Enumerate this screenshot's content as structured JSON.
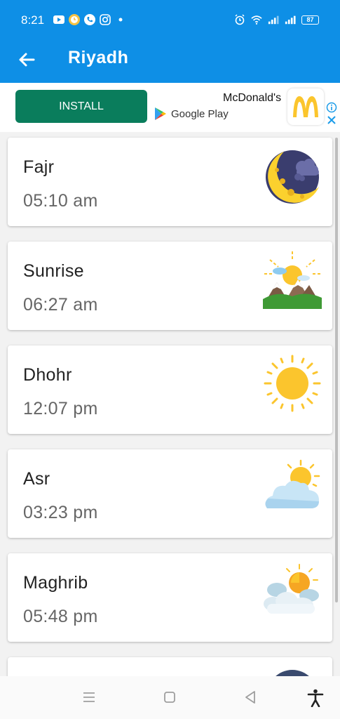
{
  "status_bar": {
    "time": "8:21",
    "battery": "87",
    "left_icons": [
      "youtube-icon",
      "clock-app-icon",
      "phone-icon",
      "instagram-icon",
      "dot-icon"
    ],
    "right_icons": [
      "alarm-icon",
      "wifi-icon",
      "signal-icon",
      "signal-icon",
      "battery-icon"
    ]
  },
  "app_bar": {
    "title": "Riyadh"
  },
  "ad": {
    "install_label": "INSTALL",
    "advertiser": "McDonald's",
    "store_label": "Google Play",
    "brand_color": "#0a7d5c"
  },
  "prayers": [
    {
      "name": "Fajr",
      "time": "05:10 am",
      "icon": "crescent-moon-icon"
    },
    {
      "name": "Sunrise",
      "time": "06:27 am",
      "icon": "sunrise-mountains-icon"
    },
    {
      "name": "Dhohr",
      "time": "12:07 pm",
      "icon": "sun-icon"
    },
    {
      "name": "Asr",
      "time": "03:23 pm",
      "icon": "sun-cloud-icon"
    },
    {
      "name": "Maghrib",
      "time": "05:48 pm",
      "icon": "sun-clouds-icon"
    }
  ],
  "colors": {
    "primary": "#0e8fe6",
    "sun": "#fbc52d"
  }
}
